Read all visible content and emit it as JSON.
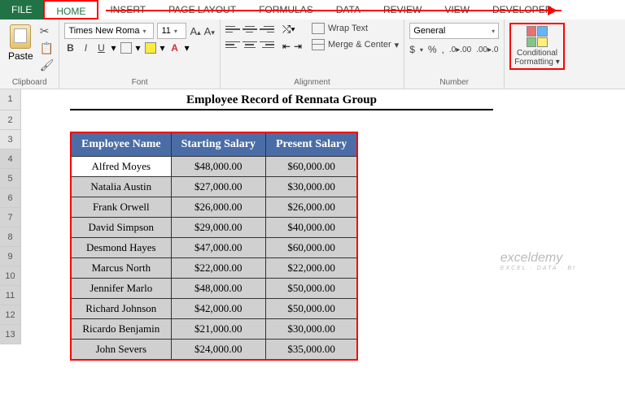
{
  "tabs": {
    "file": "FILE",
    "home": "HOME",
    "insert": "INSERT",
    "pagelayout": "PAGE LAYOUT",
    "formulas": "FORMULAS",
    "data": "DATA",
    "review": "REVIEW",
    "view": "VIEW",
    "developer": "DEVELOPER"
  },
  "ribbon": {
    "clipboard": {
      "paste": "Paste",
      "label": "Clipboard"
    },
    "font": {
      "name": "Times New Roma",
      "size": "11",
      "label": "Font"
    },
    "alignment": {
      "wrap": "Wrap Text",
      "merge": "Merge & Center",
      "label": "Alignment"
    },
    "number": {
      "format": "General",
      "label": "Number",
      "dollar": "$",
      "percent": "%",
      "comma": ","
    },
    "cond": {
      "line1": "Conditional",
      "line2": "Formatting"
    }
  },
  "rows": [
    "1",
    "2",
    "3",
    "4",
    "5",
    "6",
    "7",
    "8",
    "9",
    "10",
    "11",
    "12",
    "13"
  ],
  "title": "Employee Record of Rennata Group",
  "headers": [
    "Employee Name",
    "Starting Salary",
    "Present Salary"
  ],
  "data": [
    [
      "Alfred Moyes",
      "$48,000.00",
      "$60,000.00"
    ],
    [
      "Natalia Austin",
      "$27,000.00",
      "$30,000.00"
    ],
    [
      "Frank Orwell",
      "$26,000.00",
      "$26,000.00"
    ],
    [
      "David Simpson",
      "$29,000.00",
      "$40,000.00"
    ],
    [
      "Desmond Hayes",
      "$47,000.00",
      "$60,000.00"
    ],
    [
      "Marcus North",
      "$22,000.00",
      "$22,000.00"
    ],
    [
      "Jennifer Marlo",
      "$48,000.00",
      "$50,000.00"
    ],
    [
      "Richard Johnson",
      "$42,000.00",
      "$50,000.00"
    ],
    [
      "Ricardo Benjamin",
      "$21,000.00",
      "$30,000.00"
    ],
    [
      "John Severs",
      "$24,000.00",
      "$35,000.00"
    ]
  ],
  "watermark": {
    "main": "exceldemy",
    "sub": "EXCEL · DATA · BI"
  }
}
